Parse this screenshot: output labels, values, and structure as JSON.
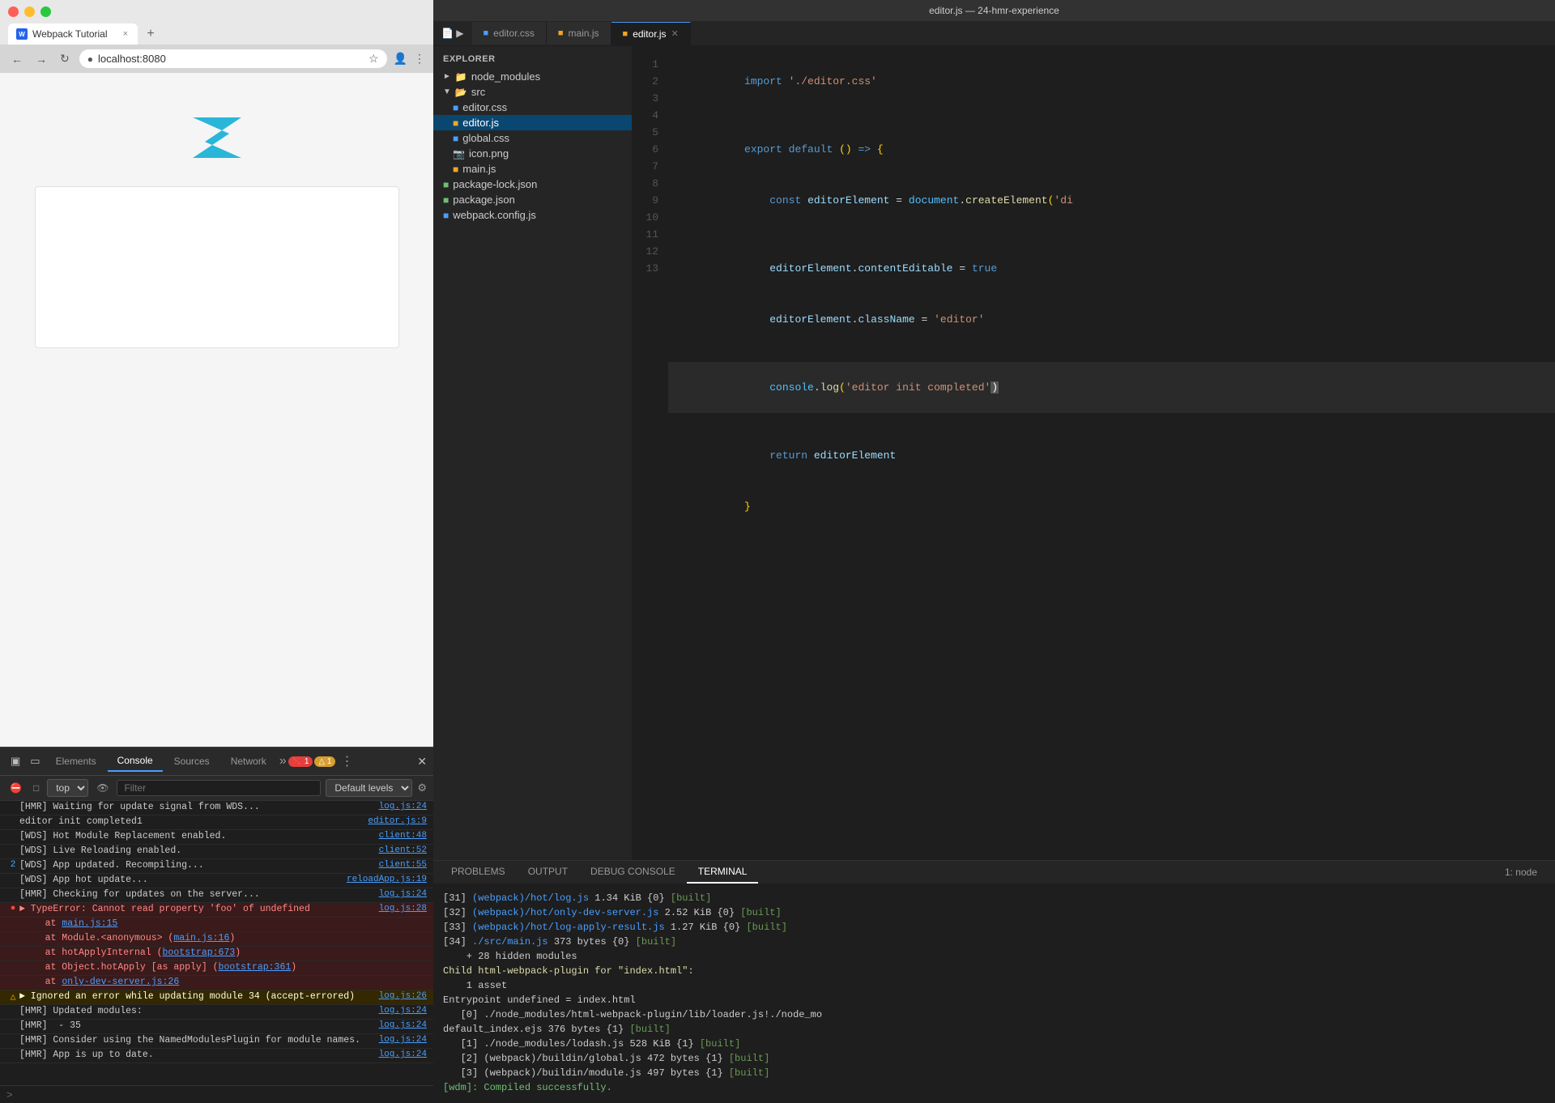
{
  "window": {
    "title": "editor.js — 24-hmr-experience"
  },
  "browser": {
    "traffic_lights": [
      "close",
      "minimize",
      "maximize"
    ],
    "tab_title": "Webpack Tutorial",
    "url": "localhost:8080",
    "tab_close": "×",
    "new_tab": "+"
  },
  "devtools": {
    "tabs": [
      "Elements",
      "Console",
      "Sources",
      "Network"
    ],
    "active_tab": "Console",
    "error_count": "1",
    "warn_count": "1",
    "more_tools": "»",
    "close": "×",
    "context": "top",
    "filter_placeholder": "Filter",
    "levels": "Default levels",
    "console_lines": [
      {
        "type": "normal",
        "text": "[HMR] Waiting for update signal from WDS...",
        "source": "log.js:24"
      },
      {
        "type": "normal",
        "text": "editor init completed1",
        "source": "editor.js:9"
      },
      {
        "type": "normal",
        "text": "[WDS] Hot Module Replacement enabled.",
        "source": "client:48"
      },
      {
        "type": "normal",
        "text": "[WDS] Live Reloading enabled.",
        "source": "client:52"
      },
      {
        "type": "info",
        "text": "2 [WDS] App updated. Recompiling...",
        "source": "client:55"
      },
      {
        "type": "normal",
        "text": "[WDS] App hot update...",
        "source": "reloadApp.js:19"
      },
      {
        "type": "normal",
        "text": "[HMR] Checking for updates on the server...",
        "source": "log.js:24"
      },
      {
        "type": "error",
        "text": "▶ TypeError: Cannot read property 'foo' of undefined",
        "source": "log.js:28"
      },
      {
        "type": "error_detail",
        "text": "at main.js:15"
      },
      {
        "type": "error_detail",
        "text": "at Module.<anonymous> (main.js:16)"
      },
      {
        "type": "error_detail",
        "text": "at hotApplyInternal (bootstrap:673)"
      },
      {
        "type": "error_detail",
        "text": "at Object.hotApply [as apply] (bootstrap:361)"
      },
      {
        "type": "error_detail",
        "text": "at only-dev-server.js:26"
      },
      {
        "type": "warning",
        "text": "▶ Ignored an error while updating module 34 (accept-errored)",
        "source": "log.js:26"
      },
      {
        "type": "normal",
        "text": "[HMR] Updated modules:",
        "source": "log.js:24"
      },
      {
        "type": "normal",
        "text": "[HMR]  - 35",
        "source": "log.js:24"
      },
      {
        "type": "normal",
        "text": "[HMR] Consider using the NamedModulesPlugin for module names.",
        "source": "log.js:24"
      },
      {
        "type": "normal",
        "text": "[HMR] App is up to date.",
        "source": "log.js:24"
      }
    ]
  },
  "vscode": {
    "tabs": [
      {
        "name": "editor.css",
        "type": "css",
        "active": false
      },
      {
        "name": "main.js",
        "type": "js",
        "active": false
      },
      {
        "name": "editor.js",
        "type": "js",
        "active": true
      }
    ],
    "explorer": {
      "header": "Explorer",
      "items": [
        {
          "type": "folder",
          "name": "node_modules",
          "level": 0,
          "open": false
        },
        {
          "type": "folder",
          "name": "src",
          "level": 0,
          "open": true
        },
        {
          "type": "css",
          "name": "editor.css",
          "level": 1
        },
        {
          "type": "js",
          "name": "editor.js",
          "level": 1,
          "active": true
        },
        {
          "type": "css",
          "name": "global.css",
          "level": 1
        },
        {
          "type": "image",
          "name": "icon.png",
          "level": 1
        },
        {
          "type": "js",
          "name": "main.js",
          "level": 1
        },
        {
          "type": "json",
          "name": "package-lock.json",
          "level": 0
        },
        {
          "type": "json",
          "name": "package.json",
          "level": 0
        },
        {
          "type": "webpack",
          "name": "webpack.config.js",
          "level": 0
        }
      ]
    },
    "code": {
      "filename": "editor.js",
      "lines": [
        {
          "num": 1,
          "content": "import './editor.css'"
        },
        {
          "num": 2,
          "content": ""
        },
        {
          "num": 3,
          "content": "export default () => {"
        },
        {
          "num": 4,
          "content": "    const editorElement = document.createElement('di"
        },
        {
          "num": 5,
          "content": ""
        },
        {
          "num": 6,
          "content": "    editorElement.contentEditable = true"
        },
        {
          "num": 7,
          "content": "    editorElement.className = 'editor'"
        },
        {
          "num": 8,
          "content": ""
        },
        {
          "num": 9,
          "content": "    console.log('editor init completed')"
        },
        {
          "num": 10,
          "content": ""
        },
        {
          "num": 11,
          "content": "    return editorElement"
        },
        {
          "num": 12,
          "content": "}"
        },
        {
          "num": 13,
          "content": ""
        }
      ]
    },
    "panel": {
      "tabs": [
        "PROBLEMS",
        "OUTPUT",
        "DEBUG CONSOLE",
        "TERMINAL"
      ],
      "active_tab": "TERMINAL",
      "terminal_label": "1: node",
      "terminal_lines": [
        "[31] (webpack)/hot/log.js 1.34 KiB {0} [built]",
        "[32] (webpack)/hot/only-dev-server.js 2.52 KiB {0} [built]",
        "[33] (webpack)/hot/log-apply-result.js 1.27 KiB {0} [built]",
        "[34] ./src/main.js 373 bytes {0} [built]",
        "    + 28 hidden modules",
        "Child html-webpack-plugin for \"index.html\":",
        "    1 asset",
        "Entrypoint undefined = index.html",
        "   [0] ./node_modules/html-webpack-plugin/lib/loader.js!./node_mo",
        "default_index.ejs 376 bytes {1} [built]",
        "   [1] ./node_modules/lodash.js 528 KiB {1} [built]",
        "   [2] (webpack)/buildin/global.js 472 bytes {1} [built]",
        "   [3] (webpack)/buildin/module.js 497 bytes {1} [built]",
        "[wdm]: Compiled successfully."
      ]
    }
  }
}
